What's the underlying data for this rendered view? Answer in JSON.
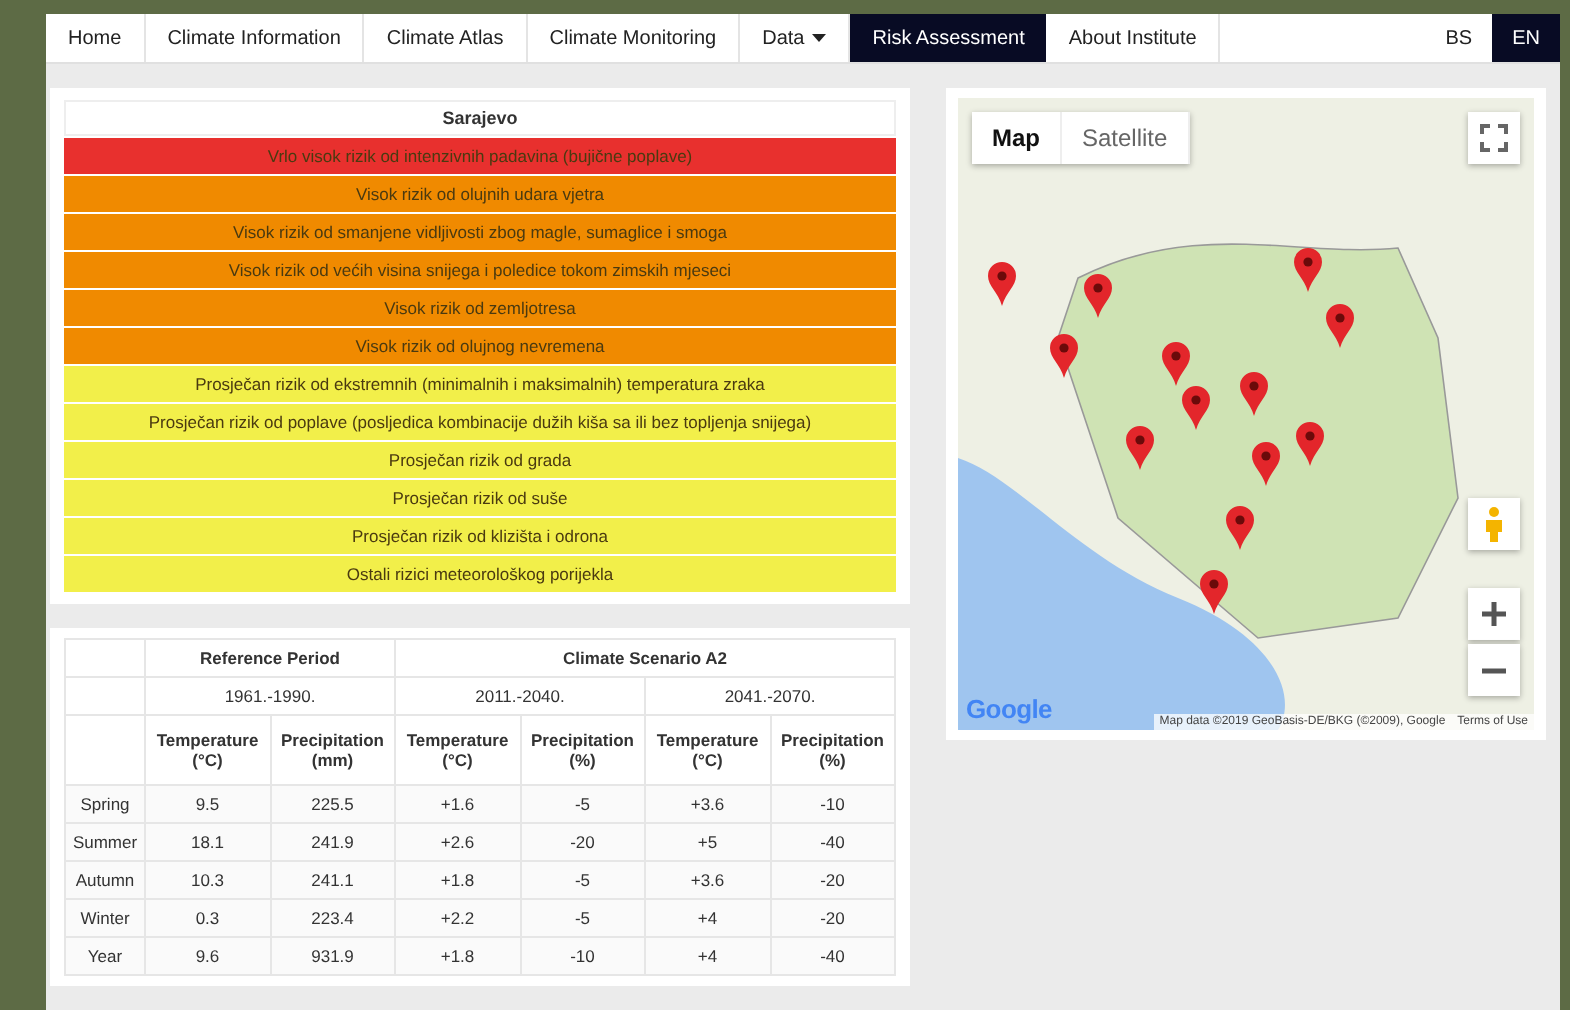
{
  "nav": {
    "items": [
      {
        "label": "Home",
        "selected": false,
        "kind": "link"
      },
      {
        "label": "Climate Information",
        "selected": false,
        "kind": "link"
      },
      {
        "label": "Climate Atlas",
        "selected": false,
        "kind": "link"
      },
      {
        "label": "Climate Monitoring",
        "selected": false,
        "kind": "link"
      },
      {
        "label": "Data",
        "selected": false,
        "kind": "dropdown"
      },
      {
        "label": "Risk Assessment",
        "selected": true,
        "kind": "link"
      },
      {
        "label": "About Institute",
        "selected": false,
        "kind": "link"
      }
    ],
    "languages": [
      {
        "label": "BS",
        "selected": false
      },
      {
        "label": "EN",
        "selected": true
      }
    ]
  },
  "risks": {
    "title": "Sarajevo",
    "rows": [
      {
        "text": "Vrlo visok rizik od intenzivnih padavina (bujične poplave)",
        "color": "#e8302e"
      },
      {
        "text": "Visok rizik od olujnih udara vjetra",
        "color": "#f08a00"
      },
      {
        "text": "Visok rizik od smanjene vidljivosti zbog magle, sumaglice i smoga",
        "color": "#f08a00"
      },
      {
        "text": "Visok rizik od većih visina snijega i poledice tokom zimskih mjeseci",
        "color": "#f08a00"
      },
      {
        "text": "Visok rizik od zemljotresa",
        "color": "#f08a00"
      },
      {
        "text": "Visok rizik od olujnog nevremena",
        "color": "#f08a00"
      },
      {
        "text": "Prosječan rizik od ekstremnih (minimalnih i maksimalnih) temperatura zraka",
        "color": "#f2ef4a"
      },
      {
        "text": "Prosječan rizik od poplave (posljedica kombinacije dužih kiša sa ili bez topljenja snijega)",
        "color": "#f2ef4a"
      },
      {
        "text": "Prosječan rizik od grada",
        "color": "#f2ef4a"
      },
      {
        "text": "Prosječan rizik od suše",
        "color": "#f2ef4a"
      },
      {
        "text": "Prosječan rizik od klizišta i odrona",
        "color": "#f2ef4a"
      },
      {
        "text": "Ostali rizici meteorološkog porijekla",
        "color": "#f2ef4a"
      }
    ]
  },
  "climate_table": {
    "groups": [
      {
        "label": "Reference Period",
        "periods": [
          "1961.-1990."
        ]
      },
      {
        "label": "Climate Scenario A2",
        "periods": [
          "2011.-2040.",
          "2041.-2070."
        ]
      }
    ],
    "columns": [
      "Temperature (°C)",
      "Precipitation (mm)",
      "Temperature (°C)",
      "Precipitation (%)",
      "Temperature (°C)",
      "Precipitation (%)"
    ],
    "rows": [
      {
        "season": "Spring",
        "values": [
          "9.5",
          "225.5",
          "+1.6",
          "-5",
          "+3.6",
          "-10"
        ]
      },
      {
        "season": "Summer",
        "values": [
          "18.1",
          "241.9",
          "+2.6",
          "-20",
          "+5",
          "-40"
        ]
      },
      {
        "season": "Autumn",
        "values": [
          "10.3",
          "241.1",
          "+1.8",
          "-5",
          "+3.6",
          "-20"
        ]
      },
      {
        "season": "Winter",
        "values": [
          "0.3",
          "223.4",
          "+2.2",
          "-5",
          "+4",
          "-20"
        ]
      },
      {
        "season": "Year",
        "values": [
          "9.6",
          "931.9",
          "+1.8",
          "-10",
          "+4",
          "-40"
        ]
      }
    ]
  },
  "map": {
    "map_types": [
      {
        "label": "Map",
        "selected": true
      },
      {
        "label": "Satellite",
        "selected": false
      }
    ],
    "logo": "Google",
    "attribution": "Map data ©2019 GeoBasis-DE/BKG (©2009), Google",
    "terms": "Terms of Use"
  }
}
